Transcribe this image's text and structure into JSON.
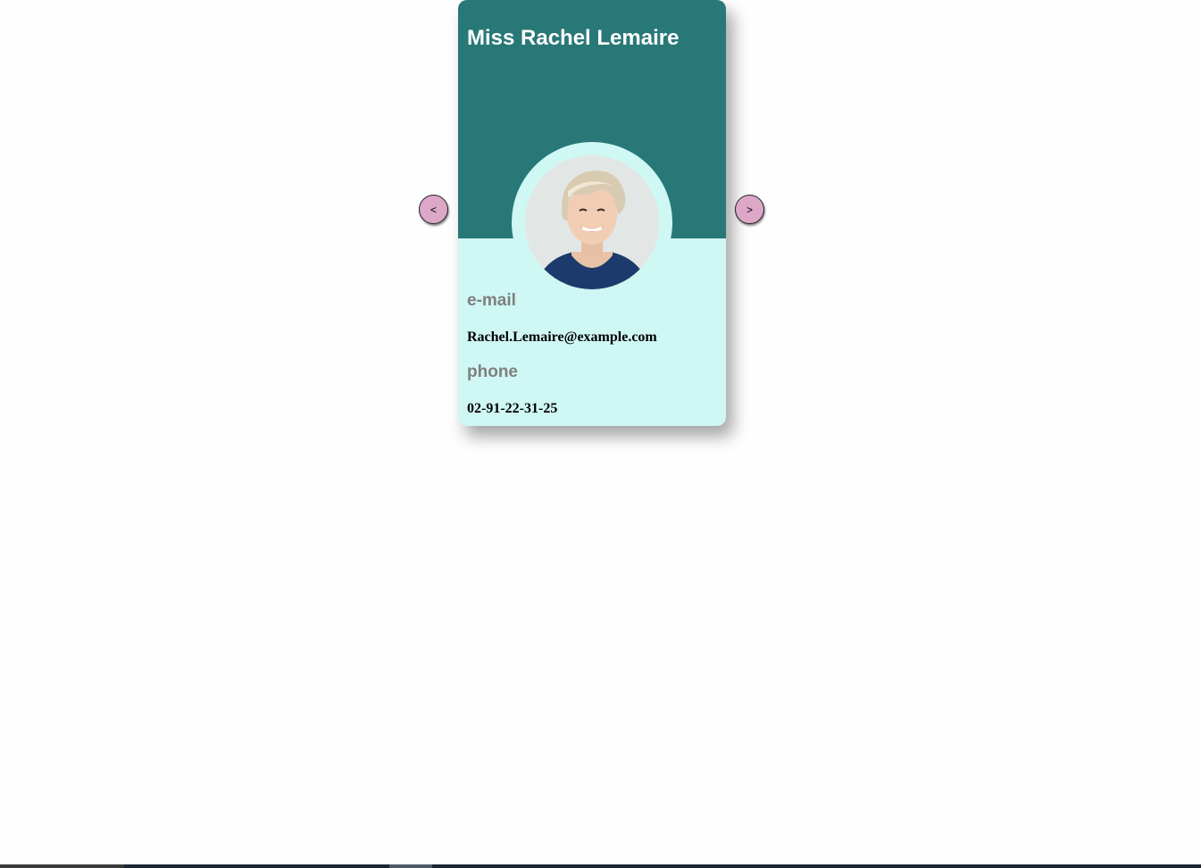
{
  "card": {
    "name": "Miss Rachel Lemaire",
    "email_label": "e-mail",
    "email": "Rachel.Lemaire@example.com",
    "phone_label": "phone",
    "phone": "02-91-22-31-25"
  },
  "navigation": {
    "prev_label": "<",
    "next_label": ">"
  },
  "colors": {
    "header": "#287878",
    "card_body": "#cff7f3",
    "nav_button": "#dda7c8",
    "label_text": "#808080"
  }
}
